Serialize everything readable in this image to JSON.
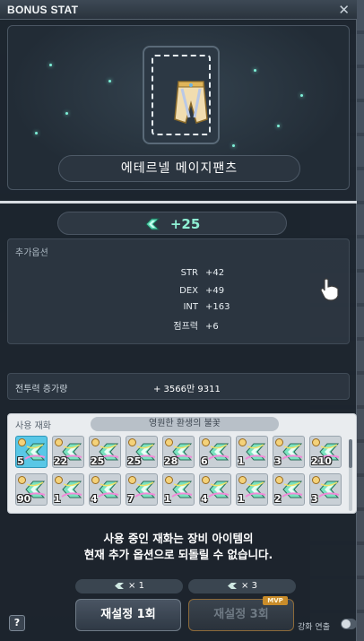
{
  "window": {
    "title": "BONUS STAT",
    "close_icon": "close-x-icon"
  },
  "item": {
    "name": "에테르넬 메이지팬츠",
    "icon": "mage-pants-icon"
  },
  "stat": {
    "icon": "bonus-stat-icon",
    "value": "+25"
  },
  "options": {
    "label": "추가옵션",
    "rows": [
      {
        "key": "STR",
        "value": "+42"
      },
      {
        "key": "DEX",
        "value": "+49"
      },
      {
        "key": "INT",
        "value": "+163"
      },
      {
        "key": "점프력",
        "value": "+6"
      }
    ]
  },
  "combat_power": {
    "label": "전투력 증가량",
    "value": "+ 3566만 9311"
  },
  "materials": {
    "label": "사용 재화",
    "title": "영원한 환생의 불꽃",
    "items": [
      {
        "count": "5",
        "selected": true
      },
      {
        "count": "22",
        "selected": false
      },
      {
        "count": "25",
        "selected": false
      },
      {
        "count": "25",
        "selected": false
      },
      {
        "count": "28",
        "selected": false
      },
      {
        "count": "6",
        "selected": false
      },
      {
        "count": "1",
        "selected": false
      },
      {
        "count": "3",
        "selected": false
      },
      {
        "count": "210",
        "selected": false
      },
      {
        "count": "90",
        "selected": false
      },
      {
        "count": "1",
        "selected": false
      },
      {
        "count": "4",
        "selected": false
      },
      {
        "count": "7",
        "selected": false
      },
      {
        "count": "1",
        "selected": false
      },
      {
        "count": "4",
        "selected": false
      },
      {
        "count": "1",
        "selected": false
      },
      {
        "count": "2",
        "selected": false
      },
      {
        "count": "3",
        "selected": false
      }
    ]
  },
  "warning": {
    "line1": "사용 중인 재화는 장비 아이템의",
    "line2": "현재 추가 옵션으로 되돌릴 수 없습니다."
  },
  "costs": {
    "one": "× 1",
    "three": "× 3"
  },
  "buttons": {
    "reset_one": "재설정 1회",
    "reset_three": "재설정 3회",
    "mvp_tag": "MVP",
    "help": "?"
  },
  "chain": {
    "label": "강화 연출"
  }
}
